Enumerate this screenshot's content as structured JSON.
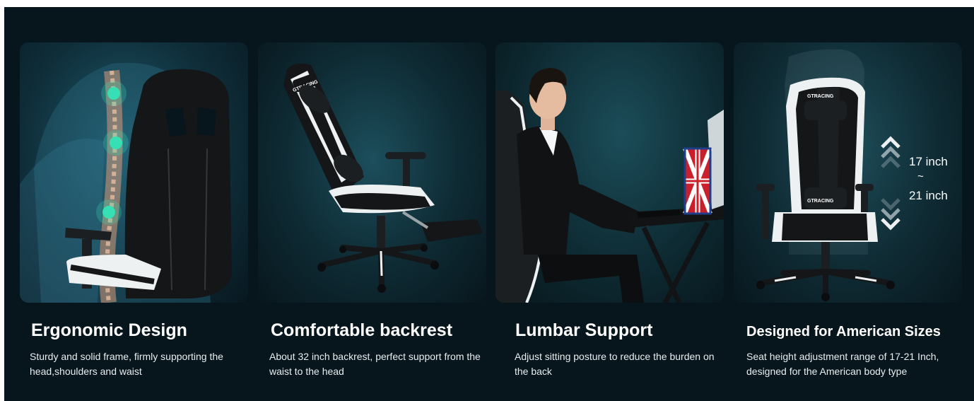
{
  "features": [
    {
      "title": "Ergonomic Design",
      "description": "Sturdy and solid frame, firmly supporting the head,shoulders and waist",
      "image": "chair-back-spine-illustration"
    },
    {
      "title": "Comfortable backrest",
      "description": "About 32 inch backrest, perfect support from the waist to the head",
      "image": "reclined-chair-with-footrest"
    },
    {
      "title": "Lumbar Support",
      "description": "Adjust sitting posture to reduce the burden on the back",
      "image": "man-sitting-at-desk"
    },
    {
      "title": "Designed for American Sizes",
      "description": "Seat height adjustment range of 17-21 Inch, designed for the American body type",
      "image": "chair-height-adjustment",
      "height_range": {
        "top": "17 inch",
        "separator": "~",
        "bottom": "21 inch"
      }
    }
  ],
  "brand_mark": "GTRACING",
  "colors": {
    "background": "#07151c",
    "text": "#ffffff",
    "chair_black": "#141618",
    "chair_white": "#eef1f2",
    "spine_glow": "#37e0b4"
  }
}
